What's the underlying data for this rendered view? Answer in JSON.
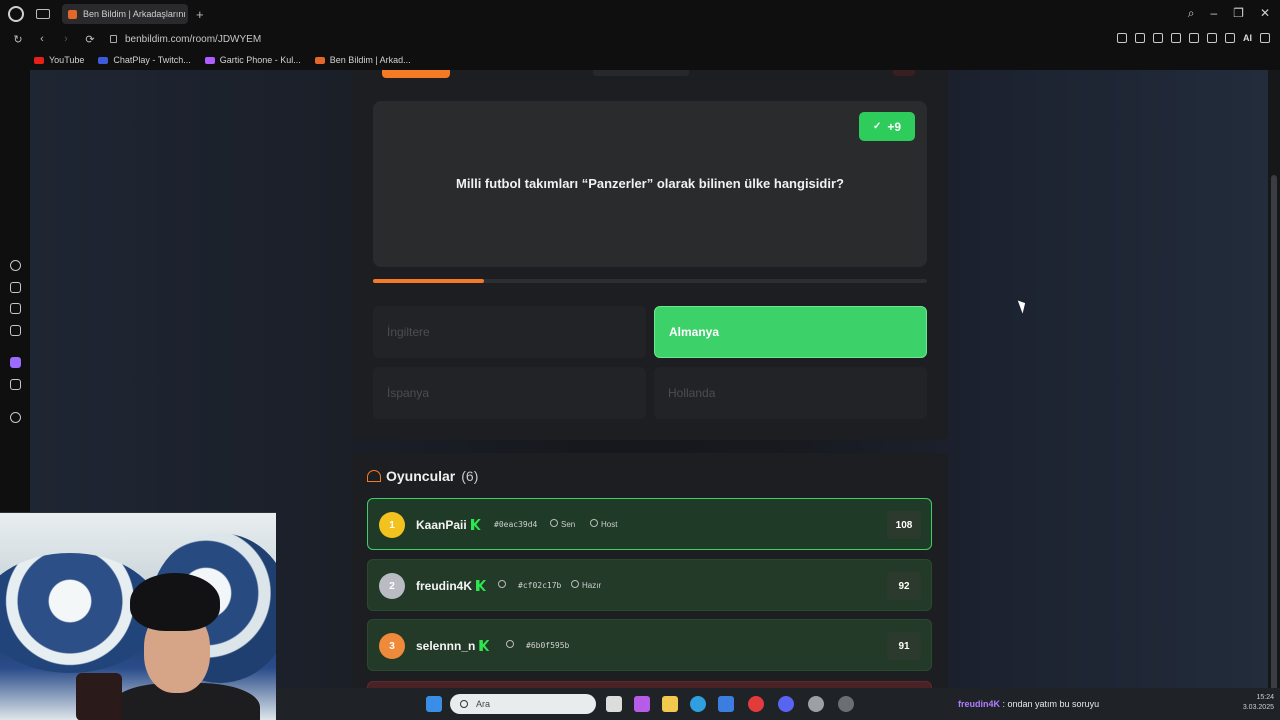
{
  "browser": {
    "tab_title": "Ben Bildim | Arkadaşlarını",
    "url": "benbildim.com/room/JDWYEM",
    "bookmarks": [
      {
        "label": "YouTube",
        "color": "#e62117"
      },
      {
        "label": "ChatPlay - Twitch...",
        "color": "#3b5bdb"
      },
      {
        "label": "Gartic Phone - Kul...",
        "color": "#b05cff"
      },
      {
        "label": "Ben Bildim | Arkad...",
        "color": "#e2672b"
      }
    ],
    "ai_label": "AI"
  },
  "question": {
    "points": "+9",
    "text": "Milli futbol takımları “Panzerler” olarak bilinen ülke hangisidir?",
    "timer_progress": 0.2
  },
  "answers": [
    {
      "label": "İngiltere",
      "state": "disabled"
    },
    {
      "label": "Almanya",
      "state": "correct"
    },
    {
      "label": "İspanya",
      "state": "disabled"
    },
    {
      "label": "Hollanda",
      "state": "disabled"
    }
  ],
  "players": {
    "title": "Oyuncular",
    "count": "(6)",
    "list": [
      {
        "rank": "1",
        "name": "KaanPaii",
        "id": "#0eac39d4",
        "tag1": "Sen",
        "tag2": "Host",
        "score": "108"
      },
      {
        "rank": "2",
        "name": "freudin4K",
        "id": "#cf02c17b",
        "tag1": "Hazır",
        "tag2": "",
        "score": "92"
      },
      {
        "rank": "3",
        "name": "selennn_n",
        "id": "#6b0f595b",
        "tag1": "",
        "tag2": "",
        "score": "91"
      }
    ]
  },
  "taskbar": {
    "search_placeholder": "Ara",
    "chat_user": "freudin4K",
    "chat_text": " : ondan yatım bu soruyu",
    "time": "15:24",
    "date": "3.03.2025"
  }
}
